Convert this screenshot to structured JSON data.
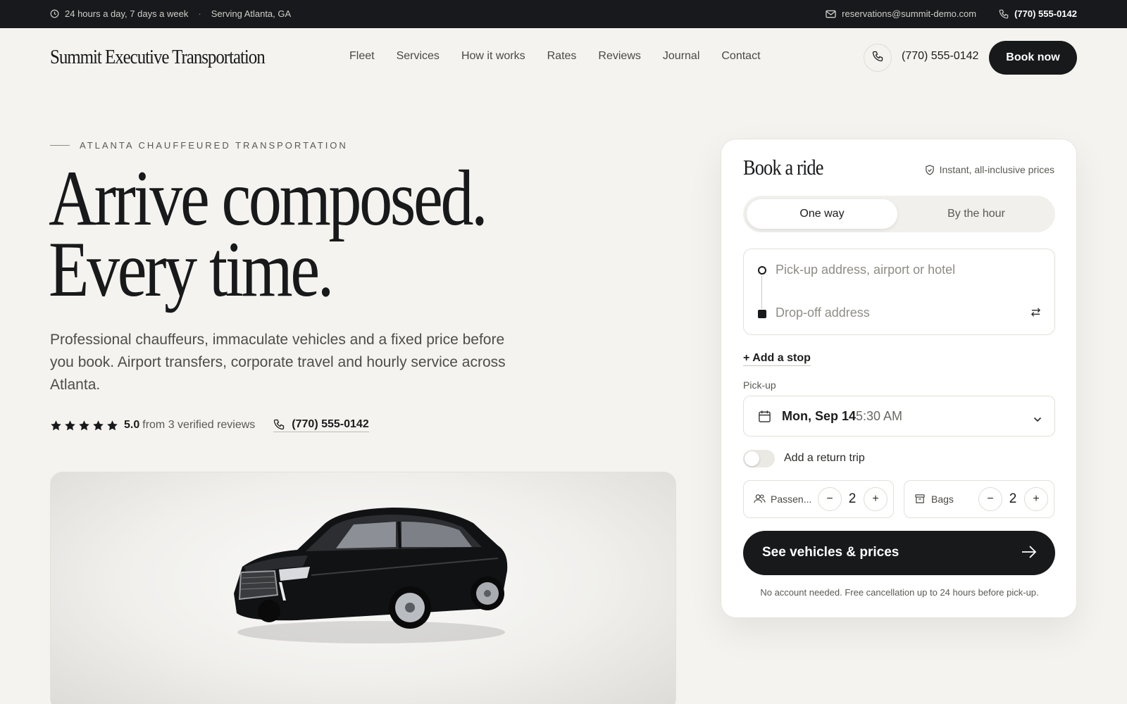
{
  "topbar": {
    "hours": "24 hours a day, 7 days a week",
    "separator": "·",
    "area": "Serving Atlanta, GA",
    "email": "reservations@summit-demo.com",
    "phone": "(770) 555-0142"
  },
  "header": {
    "brand": "Summit Executive Transportation",
    "nav": [
      "Fleet",
      "Services",
      "How it works",
      "Rates",
      "Reviews",
      "Journal",
      "Contact"
    ],
    "phone": "(770) 555-0142",
    "book_now": "Book now"
  },
  "hero": {
    "eyebrow": "ATLANTA CHAUFFEURED TRANSPORTATION",
    "headline_line1": "Arrive composed.",
    "headline_line2": "Every time.",
    "lede": "Professional chauffeurs, immaculate vehicles and a fixed price before you book. Airport transfers, corporate travel and hourly service across Atlanta.",
    "rating_score": "5.0",
    "rating_text": "from 3 verified reviews",
    "rating_stars": 5,
    "phone": "(770) 555-0142"
  },
  "booking": {
    "title": "Book a ride",
    "badge": "Instant, all-inclusive prices",
    "tabs": {
      "active": "One way",
      "inactive": "By the hour"
    },
    "pickup_placeholder": "Pick-up address, airport or hotel",
    "dropoff_placeholder": "Drop-off address",
    "add_stop": "+ Add a stop",
    "pickup_label": "Pick-up",
    "pickup_date": "Mon, Sep 14",
    "pickup_time": "5:30 AM",
    "return_trip_label": "Add a return trip",
    "return_trip_on": false,
    "passengers_label": "Passen...",
    "passengers_value": "2",
    "bags_label": "Bags",
    "bags_value": "2",
    "minus": "−",
    "plus": "+",
    "cta": "See vehicles & prices",
    "fineprint": "No account needed. Free cancellation up to 24 hours before pick-up."
  },
  "colors": {
    "background": "#f4f3ef",
    "topbar": "#17191c",
    "primary": "#18191b",
    "card": "#ffffff"
  },
  "icons": [
    "clock-icon",
    "mail-icon",
    "phone-icon",
    "star-icon",
    "shield-check-icon",
    "swap-icon",
    "calendar-icon",
    "chevron-down-icon",
    "users-icon",
    "bag-icon",
    "arrow-right-icon"
  ]
}
